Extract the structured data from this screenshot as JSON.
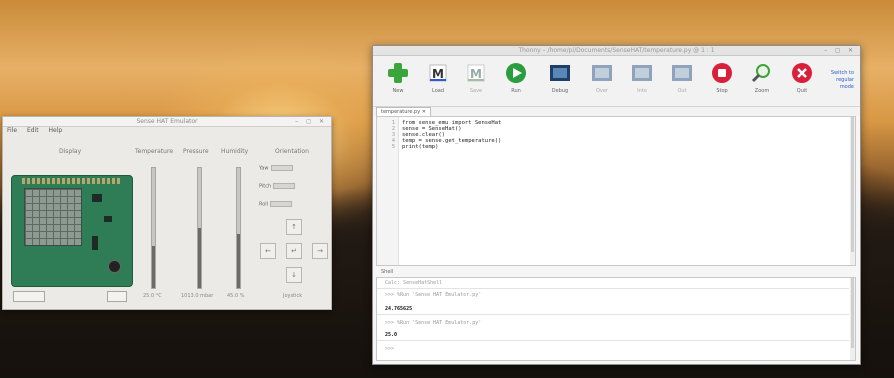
{
  "emulator": {
    "title": "Sense HAT Emulator",
    "window_controls": "– ◻ ✕",
    "menu": [
      "File",
      "Edit",
      "Help"
    ],
    "columns": {
      "board": "Display",
      "temperature": "Temperature",
      "pressure": "Pressure",
      "humidity": "Humidity",
      "orientation": "Orientation"
    },
    "orientation_labels": [
      "Yaw",
      "Pitch",
      "Roll"
    ],
    "readouts": [
      "25.0 °C",
      "1013.0 mbar",
      "45.0 %"
    ],
    "levels": {
      "temperature": 0.35,
      "pressure": 0.5,
      "humidity": 0.45
    },
    "orientation_footer": "Joystick",
    "joystick_arrows": {
      "up": "↑",
      "left": "←",
      "center": "↵",
      "right": "→",
      "down": "↓"
    }
  },
  "editor": {
    "title": "Thonny  –  /home/pi/Documents/SenseHAT/temperature.py  @  1 : 1",
    "window_controls": "– ◻ ✕",
    "toolbar": [
      {
        "label": "New",
        "icon": "plus-icon",
        "dim": false
      },
      {
        "label": "Load",
        "icon": "load-icon",
        "dim": false
      },
      {
        "label": "Save",
        "icon": "save-icon",
        "dim": true
      },
      {
        "label": "Run",
        "icon": "run-icon",
        "dim": false
      },
      {
        "label": "Debug",
        "icon": "debug-icon",
        "dim": false
      },
      {
        "label": "Over",
        "icon": "step-over-icon",
        "dim": true
      },
      {
        "label": "Into",
        "icon": "step-into-icon",
        "dim": true
      },
      {
        "label": "Out",
        "icon": "step-out-icon",
        "dim": true
      },
      {
        "label": "Stop",
        "icon": "stop-icon",
        "dim": false
      },
      {
        "label": "Zoom",
        "icon": "zoom-icon",
        "dim": false
      },
      {
        "label": "Quit",
        "icon": "quit-icon",
        "dim": false
      }
    ],
    "tab_label": "temperature.py ✕",
    "line_numbers": [
      "1",
      "2",
      "3",
      "4",
      "5"
    ],
    "code_lines": [
      "from sense_emu import SenseHat",
      "sense = SenseHat()",
      "sense.clear()",
      "temp = sense.get_temperature()",
      "print(temp)"
    ],
    "shell_label": "Shell",
    "shell": [
      {
        "kind": "prompt",
        "text": "Calc: SenseHatShell"
      },
      {
        "kind": "prompt",
        "text": ">>> %Run 'Sense HAT Emulator.py'"
      },
      {
        "kind": "out",
        "text": "24.765625"
      },
      {
        "kind": "prompt",
        "text": ">>> %Run 'Sense HAT Emulator.py'"
      },
      {
        "kind": "out",
        "text": "25.0"
      },
      {
        "kind": "prompt",
        "text": ">>>"
      }
    ],
    "zoom_text": [
      "Switch to",
      "regular",
      "mode"
    ]
  },
  "colors": {
    "green": "#3aa53a",
    "stop_red": "#d8203a",
    "run_green": "#2a9d3f",
    "link_blue": "#2d5bd3"
  }
}
